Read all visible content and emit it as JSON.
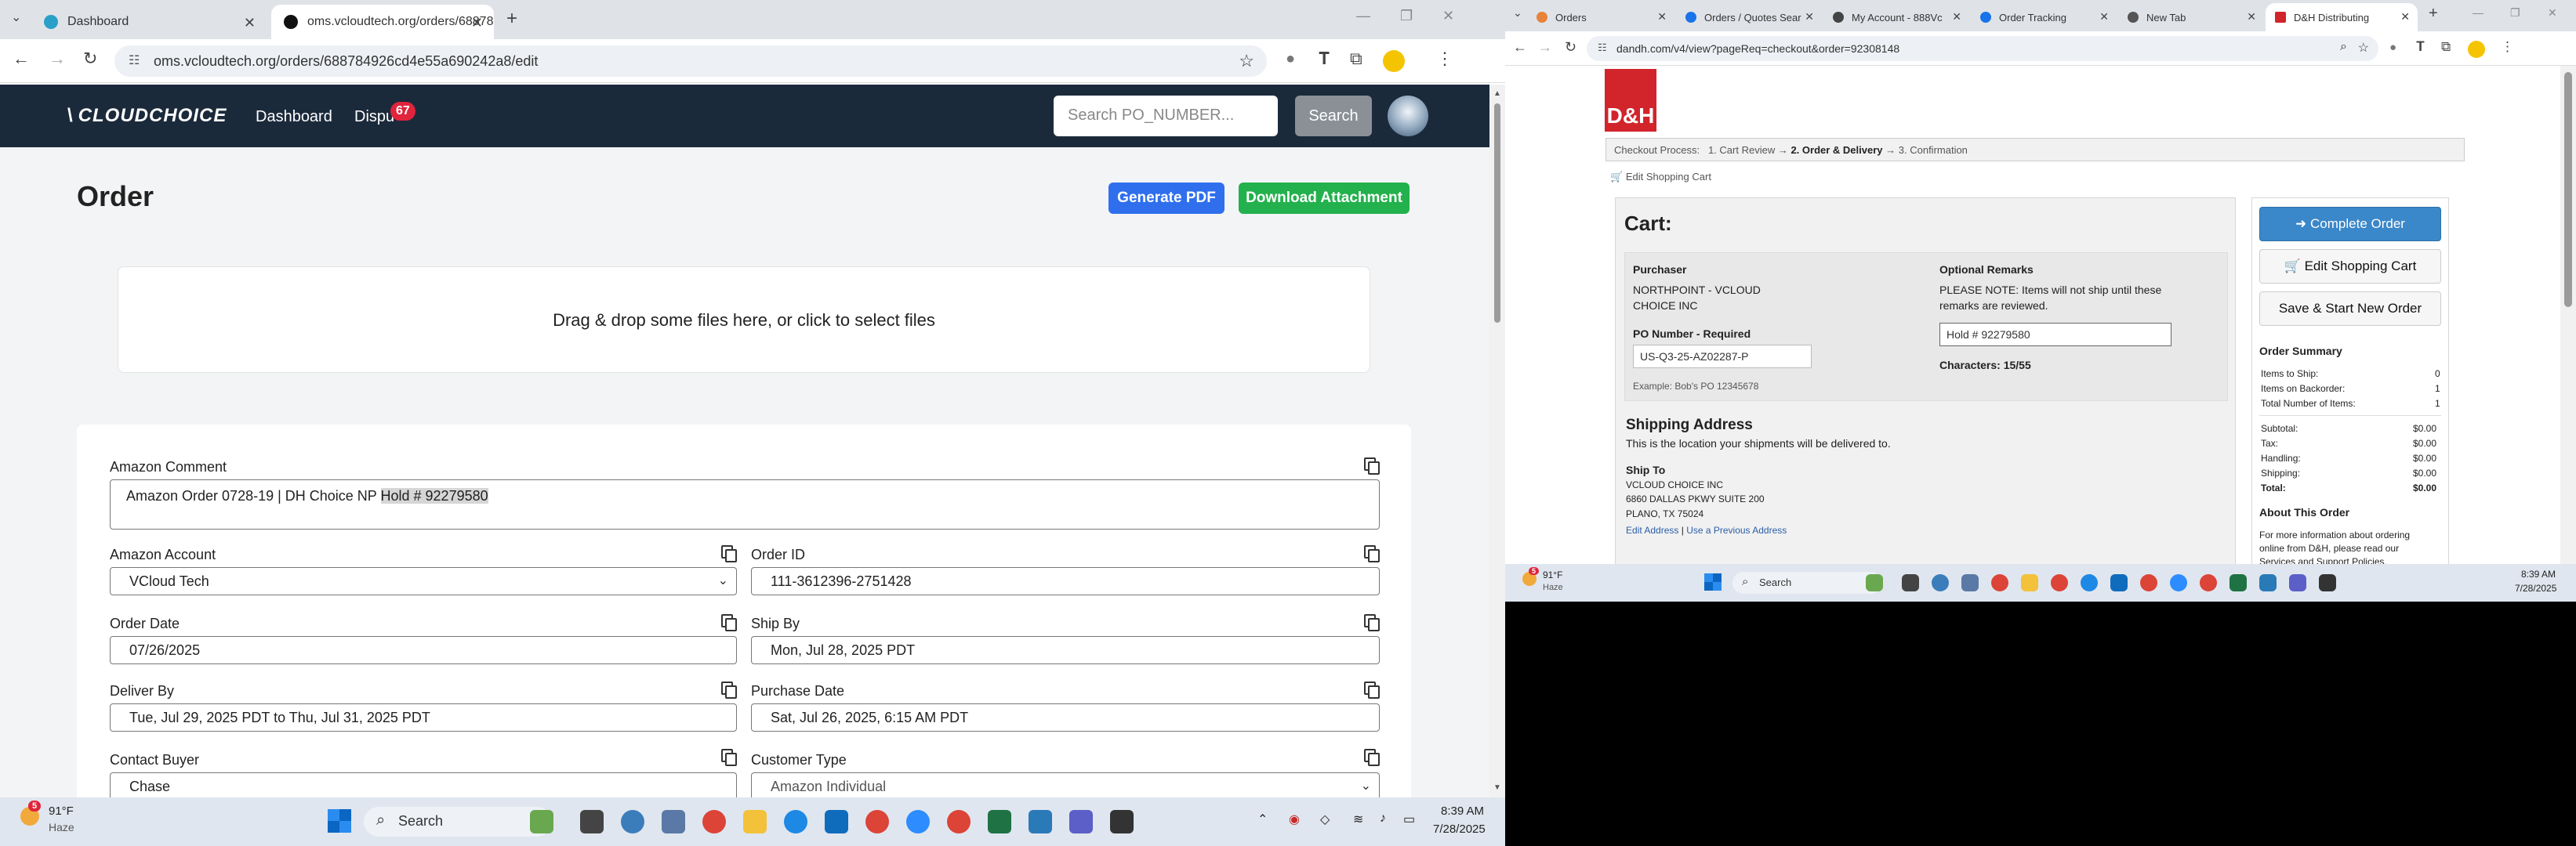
{
  "left": {
    "tabs": [
      {
        "label": "Dashboard",
        "active": false
      },
      {
        "label": "oms.vcloudtech.org/orders/68878",
        "active": true
      }
    ],
    "url": "oms.vcloudtech.org/orders/688784926cd4e55a690242a8/edit",
    "nav": {
      "logo": "CLOUDCHOICE",
      "dashboard": "Dashboard",
      "disputes": "Dispu",
      "badge": "67",
      "search_placeholder": "Search PO_NUMBER...",
      "search_button": "Search"
    },
    "page_title": "Order",
    "buttons": {
      "pdf": "Generate PDF",
      "download": "Download Attachment"
    },
    "dropzone": "Drag & drop some files here, or click to select files",
    "form": {
      "comment_label": "Amazon Comment",
      "comment_prefix": "Amazon Order 0728-19 | DH Choice NP ",
      "comment_highlight": "Hold # 92279580",
      "account_label": "Amazon Account",
      "account_value": "VCloud Tech",
      "order_id_label": "Order ID",
      "order_id_value": "111-3612396-2751428",
      "order_date_label": "Order Date",
      "order_date_value": "07/26/2025",
      "ship_by_label": "Ship By",
      "ship_by_value": "Mon, Jul 28, 2025 PDT",
      "deliver_by_label": "Deliver By",
      "deliver_by_value": "Tue, Jul 29, 2025 PDT to Thu, Jul 31, 2025 PDT",
      "purchase_date_label": "Purchase Date",
      "purchase_date_value": "Sat, Jul 26, 2025, 6:15 AM PDT",
      "contact_label": "Contact Buyer",
      "contact_value": "Chase",
      "customer_type_label": "Customer Type",
      "customer_type_value": "Amazon Individual"
    },
    "taskbar": {
      "temp": "91°F",
      "weather": "Haze",
      "weather_badge": "5",
      "search": "Search",
      "time": "8:39 AM",
      "date": "7/28/2025"
    }
  },
  "right": {
    "tabs": [
      {
        "label": "Orders",
        "active": false
      },
      {
        "label": "Orders / Quotes Sear",
        "active": false
      },
      {
        "label": "My Account - 888Vc",
        "active": false
      },
      {
        "label": "Order Tracking",
        "active": false
      },
      {
        "label": "New Tab",
        "active": false
      },
      {
        "label": "D&H Distributing",
        "active": true
      }
    ],
    "url": "dandh.com/v4/view?pageReq=checkout&order=92308148",
    "logo": "D&H",
    "checkout": {
      "prefix": "Checkout Process:",
      "step1": "1. Cart Review",
      "arrow": "→",
      "step2": "2. Order & Delivery",
      "step3": "3. Confirmation"
    },
    "edit_cart_link": "Edit Shopping Cart",
    "cart_title": "Cart:",
    "purchaser_label": "Purchaser",
    "purchaser_line1": "NORTHPOINT - VCLOUD",
    "purchaser_line2": "CHOICE INC",
    "po_label": "PO Number - Required",
    "po_value": "US-Q3-25-AZ02287-P",
    "po_example": "Example: Bob's PO 12345678",
    "remarks_label": "Optional Remarks",
    "remarks_note1": "PLEASE NOTE: Items will not ship until these",
    "remarks_note2": "remarks are reviewed.",
    "remarks_value": "Hold # 92279580",
    "characters": "Characters: 15/55",
    "shipping_title": "Shipping Address",
    "shipping_desc": "This is the location your shipments will be delivered to.",
    "ship_to_label": "Ship To",
    "ship_line1": "VCLOUD CHOICE INC",
    "ship_line2": "6860 DALLAS PKWY SUITE 200",
    "ship_line3": "PLANO, TX 75024",
    "edit_address": "Edit Address",
    "sep": "|",
    "use_previous": "Use a Previous Address",
    "buttons": {
      "complete": "Complete Order",
      "edit_cart": "Edit Shopping Cart",
      "save_start": "Save & Start New Order"
    },
    "summary_title": "Order Summary",
    "summary": [
      [
        "Items to Ship:",
        "0"
      ],
      [
        "Items on Backorder:",
        "1"
      ],
      [
        "Total Number of Items:",
        "1"
      ]
    ],
    "totals": [
      [
        "Subtotal:",
        "$0.00"
      ],
      [
        "Tax:",
        "$0.00"
      ],
      [
        "Handling:",
        "$0.00"
      ],
      [
        "Shipping:",
        "$0.00"
      ],
      [
        "Total:",
        "$0.00"
      ]
    ],
    "about_title": "About This Order",
    "about_text1": "For more information about ordering",
    "about_text2": "online from D&H, please read our",
    "about_link": "Services and Support Policies.",
    "taskbar": {
      "temp": "91°F",
      "weather": "Haze",
      "weather_badge": "5",
      "search": "Search",
      "time": "8:39 AM",
      "date": "7/28/2025"
    }
  },
  "colors": {
    "nav_bg": "#1b2a3b",
    "primary": "#2f6fed",
    "success": "#22b14c",
    "badge": "#e0243b",
    "dh_red": "#d1242b",
    "dh_button": "#3a87c9"
  }
}
